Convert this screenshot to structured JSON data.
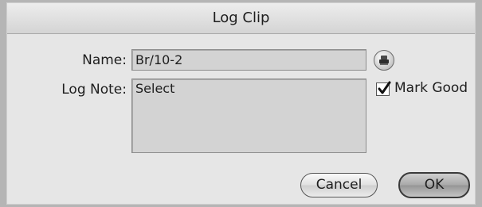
{
  "dialog": {
    "title": "Log Clip",
    "name_label": "Name:",
    "name_value": "Br/10-2",
    "log_note_label": "Log Note:",
    "log_note_value": "Select",
    "mark_good_label": "Mark Good",
    "mark_good_checked": true,
    "stamp_button_icon": "stamp-icon",
    "cancel_label": "Cancel",
    "ok_label": "OK"
  }
}
